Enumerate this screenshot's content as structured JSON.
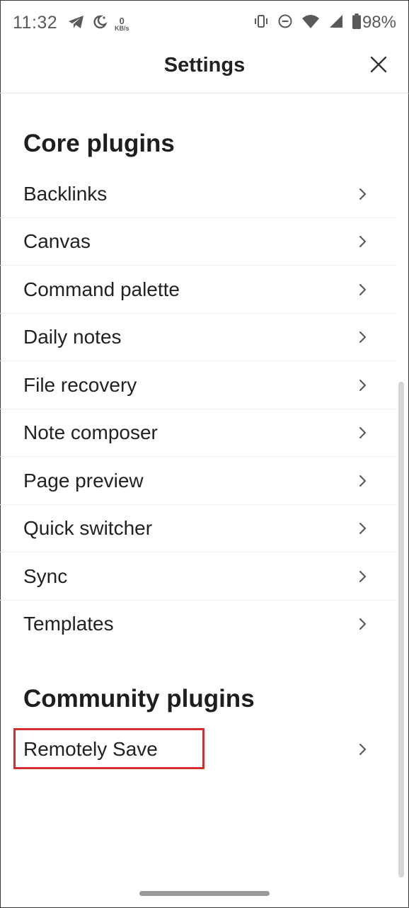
{
  "status_bar": {
    "time": "11:32",
    "net_speed_value": "0",
    "net_speed_unit": "KB/s",
    "battery": "98%"
  },
  "header": {
    "title": "Settings"
  },
  "core_plugins": {
    "heading": "Core plugins",
    "items": [
      {
        "label": "Backlinks"
      },
      {
        "label": "Canvas"
      },
      {
        "label": "Command palette"
      },
      {
        "label": "Daily notes"
      },
      {
        "label": "File recovery"
      },
      {
        "label": "Note composer"
      },
      {
        "label": "Page preview"
      },
      {
        "label": "Quick switcher"
      },
      {
        "label": "Sync"
      },
      {
        "label": "Templates"
      }
    ]
  },
  "community_plugins": {
    "heading": "Community plugins",
    "items": [
      {
        "label": "Remotely Save"
      }
    ]
  },
  "colors": {
    "highlight": "#d32f2f",
    "text": "#222222",
    "divider": "#eeeeee"
  }
}
